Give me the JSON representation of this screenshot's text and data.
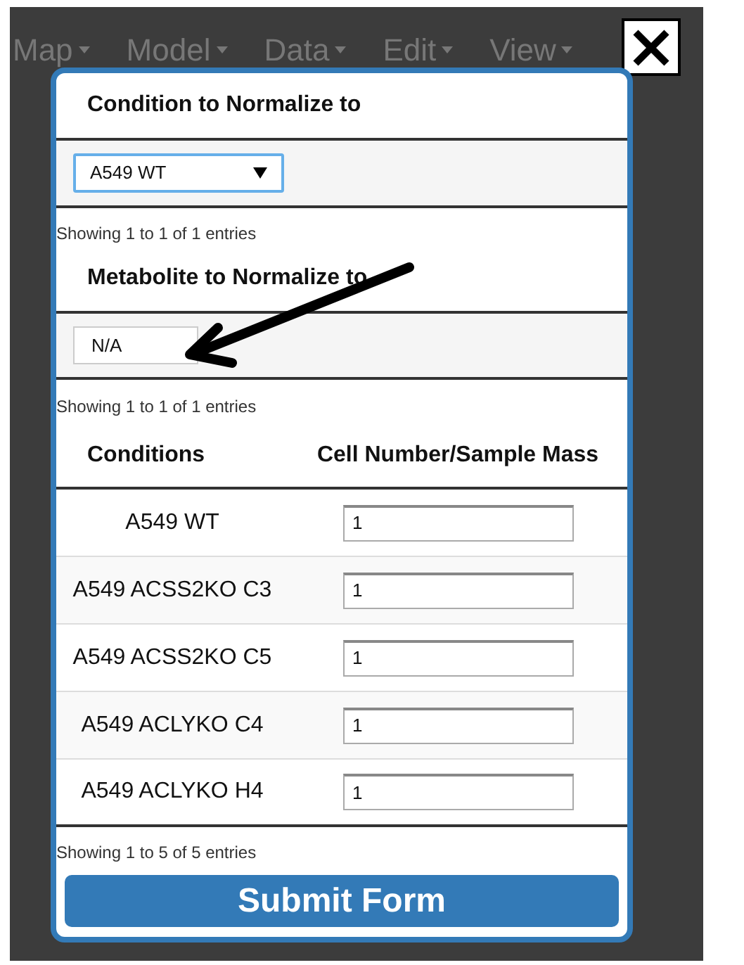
{
  "menu": [
    "Map",
    "Model",
    "Data",
    "Edit",
    "View"
  ],
  "dialog": {
    "condition_section": {
      "title": "Condition to Normalize to",
      "select_value": "A549 WT",
      "info": "Showing 1 to 1 of 1 entries"
    },
    "metabolite_section": {
      "title": "Metabolite to Normalize to",
      "value": "N/A",
      "info": "Showing 1 to 1 of 1 entries"
    },
    "table": {
      "columns": [
        "Conditions",
        "Cell Number/Sample Mass"
      ],
      "rows": [
        {
          "condition": "A549 WT",
          "value": "1"
        },
        {
          "condition": "A549 ACSS2KO C3",
          "value": "1"
        },
        {
          "condition": "A549 ACSS2KO C5",
          "value": "1"
        },
        {
          "condition": "A549 ACLYKO C4",
          "value": "1"
        },
        {
          "condition": "A549 ACLYKO H4",
          "value": "1"
        }
      ],
      "info": "Showing 1 to 5 of 5 entries"
    },
    "submit": "Submit Form"
  }
}
